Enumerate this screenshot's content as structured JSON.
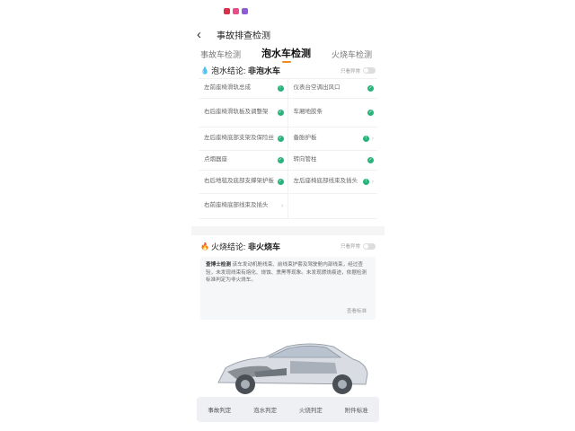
{
  "header": {
    "title": "事故排查检测"
  },
  "tabs": [
    {
      "label": "事故车检测"
    },
    {
      "label": "泡水车检测"
    },
    {
      "label": "火烧车检测"
    }
  ],
  "water": {
    "conclusion_label": "泡水结论:",
    "conclusion_value": "非泡水车",
    "toggle_label": "只看异常",
    "items": [
      {
        "label": "左前座椅滑轨总成",
        "status": "warn"
      },
      {
        "label": "仪表台空调出风口",
        "status": "ok"
      },
      {
        "label": "右后座椅滑轨板及调整架",
        "status": "ok"
      },
      {
        "label": "车厢地胶条",
        "status": "ok"
      },
      {
        "label": "左后座椅底部支架及保险丝",
        "status": "ok"
      },
      {
        "label": "备胎护板",
        "status": "warn"
      },
      {
        "label": "点烟器座",
        "status": "ok"
      },
      {
        "label": "转向管柱",
        "status": "ok"
      },
      {
        "label": "右后地毯及底部支撑架护板",
        "status": "ok"
      },
      {
        "label": "左后座椅底部线束及插头",
        "status": "warn"
      },
      {
        "label": "右前座椅底部线束及插头",
        "status": "warn"
      },
      {
        "label": "",
        "status": ""
      }
    ]
  },
  "fire": {
    "conclusion_label": "火烧结论:",
    "conclusion_value": "非火烧车",
    "toggle_label": "只看异常",
    "report_brand": "查博士检测",
    "report_text": "该车发动机舱线束、前线束护套及驾驶舱内部线束，经过查验，未发现线束有熔化、烧蚀、熏黑等现象。未发现燃烧痕迹，依据检测标准判定为非火烧车。",
    "report_link": "查看标准"
  },
  "bottom_nav": [
    {
      "label": "事故判定"
    },
    {
      "label": "泡水判定"
    },
    {
      "label": "火烧判定"
    },
    {
      "label": "附件标准"
    }
  ],
  "colors": {
    "accent": "#f08c1e",
    "ok": "#27b37a"
  }
}
